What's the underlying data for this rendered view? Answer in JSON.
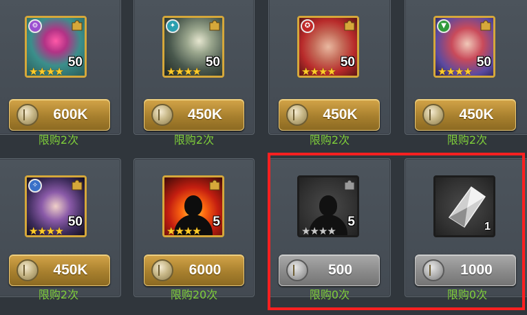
{
  "shop_items": [
    {
      "price": "600K",
      "limit": "限购2次",
      "level": "50",
      "stars": "★★★★",
      "faction": "purple",
      "color": "#9b4fd0"
    },
    {
      "price": "450K",
      "limit": "限购2次",
      "level": "50",
      "stars": "★★★★",
      "faction": "teal",
      "color": "#2a9fb0"
    },
    {
      "price": "450K",
      "limit": "限购2次",
      "level": "50",
      "stars": "★★★★",
      "faction": "red",
      "color": "#c02828"
    },
    {
      "price": "450K",
      "limit": "限购2次",
      "level": "50",
      "stars": "★★★★",
      "faction": "green",
      "color": "#2f9a3a"
    },
    {
      "price": "450K",
      "limit": "限购2次",
      "level": "50",
      "stars": "★★★★",
      "faction": "blue",
      "color": "#3a70c8"
    },
    {
      "price": "6000",
      "limit": "限购20次",
      "level": "5",
      "stars": "★★★★",
      "type": "hero-shard"
    },
    {
      "price": "500",
      "limit": "限购0次",
      "level": "5",
      "stars": "★★★★",
      "type": "hero-shard-soldout"
    },
    {
      "price": "1000",
      "limit": "限购0次",
      "count": "1",
      "type": "crystal-soldout"
    }
  ],
  "colors": {
    "background": "#30363c",
    "gold_button": "#b88c34",
    "gray_button": "#8a8a8a",
    "limit_text": "#7fcf3a",
    "highlight": "#ff2020"
  }
}
